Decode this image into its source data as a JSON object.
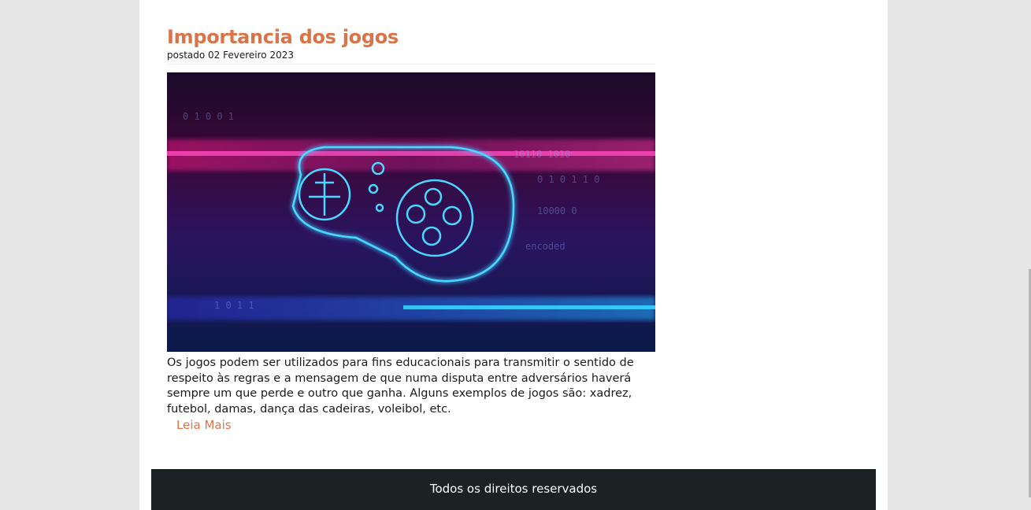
{
  "post": {
    "title": "Importancia dos jogos",
    "date": "postado 02 Fevereiro 2023",
    "body": "Os jogos podem ser utilizados para fins educacionais para transmitir o sentido de respeito às regras e a mensagem de que numa disputa entre adversários haverá sempre um que perde e outro que ganha. Alguns exemplos de jogos são: xadrez, futebol, damas, dança das cadeiras, voleibol, etc.",
    "read_more": "Leia Mais"
  },
  "footer": {
    "text": "Todos os direitos reservados"
  },
  "colors": {
    "accent": "#d9744a",
    "footer_bg": "#1c2124",
    "page_bg": "#e6e6e6"
  }
}
